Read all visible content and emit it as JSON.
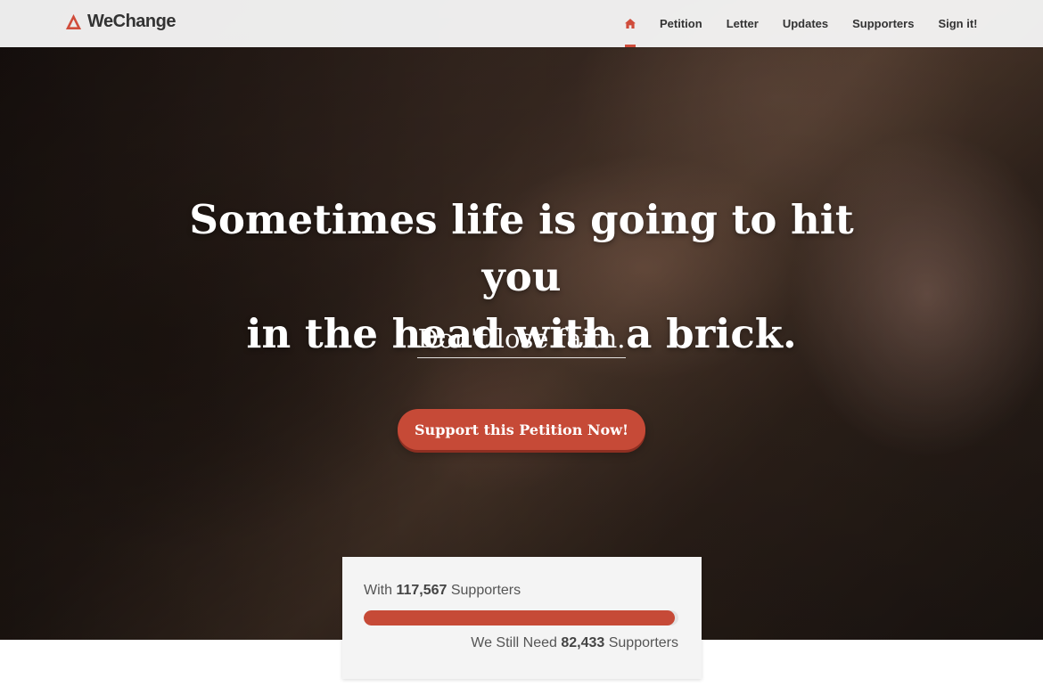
{
  "brand": {
    "name": "WeChange",
    "icon": "triangle-logo-icon",
    "accent_color": "#d04c3b"
  },
  "nav": {
    "home_icon": "home-icon",
    "items": [
      {
        "label": "Petition"
      },
      {
        "label": "Letter"
      },
      {
        "label": "Updates"
      },
      {
        "label": "Supporters"
      },
      {
        "label": "Sign it!"
      }
    ]
  },
  "hero": {
    "title_line1": "Sometimes life is going to hit you",
    "title_line2": "in the head with a brick.",
    "subtitle": "Don't lose faith.",
    "cta_label": "Support this Petition Now!",
    "cta_color": "#c64a37"
  },
  "progress": {
    "with_prefix": "With ",
    "supporters_count": "117,567",
    "supporters_suffix": " Supporters",
    "need_prefix": "We Still Need ",
    "needed_count": "82,433",
    "needed_suffix": " Supporters",
    "fill_fraction": 0.99
  }
}
